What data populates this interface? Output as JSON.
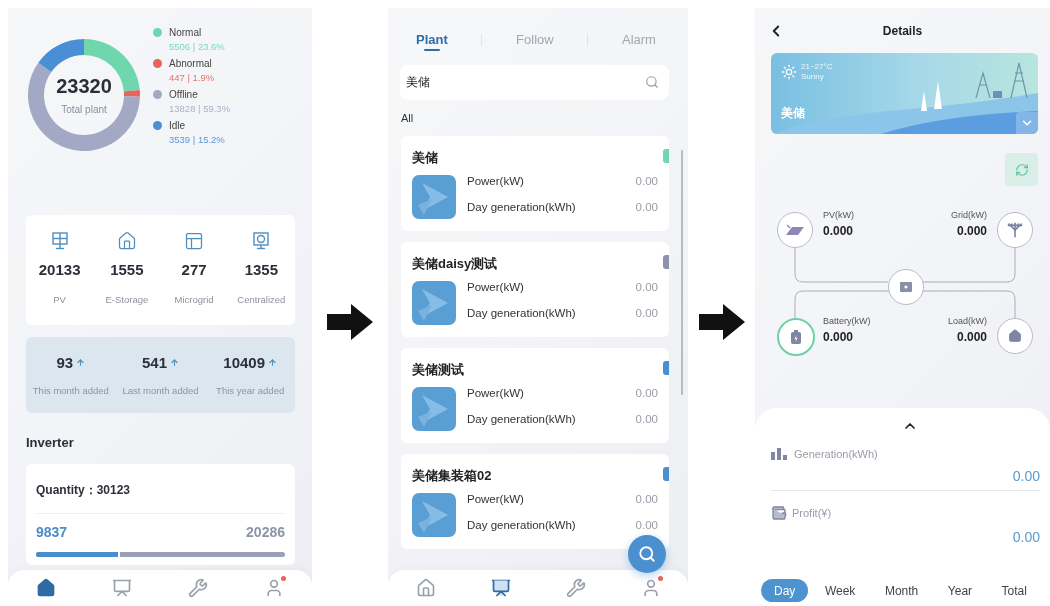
{
  "home_screen": {
    "status_chart": {
      "total": "23320",
      "total_label": "Total plant",
      "chart_data": {
        "type": "donut",
        "categories": [
          "Normal",
          "Abnormal",
          "Offline",
          "Idle"
        ],
        "series": [
          {
            "values": [
              23.6,
              1.9,
              59.3,
              15.2
            ]
          }
        ]
      },
      "legend": [
        {
          "value": "5506 | 23.6%",
          "color": "#6fd6ae"
        },
        {
          "value": "447 | 1.9%",
          "color": "#e8645a"
        },
        {
          "value": "13828 | 59.3%",
          "color": "#a3a8c4"
        },
        {
          "value": "3539 | 15.2%",
          "color": "#4a8fd6"
        }
      ]
    },
    "categories": [
      {
        "kind": "pv",
        "count": "20133",
        "label": "PV"
      },
      {
        "kind": "storage",
        "count": "1555",
        "label": "E-Storage"
      },
      {
        "kind": "microgrid",
        "count": "277",
        "label": "Microgrid"
      },
      {
        "kind": "centralized",
        "count": "1355",
        "label": "Centralized"
      }
    ],
    "added": [
      {
        "count": "93",
        "label": "This month added"
      },
      {
        "count": "541",
        "label": "Last month added"
      },
      {
        "count": "10409",
        "label": "This year added"
      }
    ],
    "inverter": {
      "title": "Inverter",
      "quantity": "Quantity：30123",
      "online": "9837",
      "offline": "20286",
      "level": 0.33
    },
    "nav": [
      {
        "kind": "home",
        "selected": true,
        "badge": false
      },
      {
        "kind": "monitor",
        "selected": false,
        "badge": false
      },
      {
        "kind": "tools",
        "selected": false,
        "badge": false
      },
      {
        "kind": "user",
        "selected": false,
        "badge": true
      }
    ]
  },
  "plant_list_screen": {
    "tabs": [
      {
        "label": "Plant",
        "selected": true
      },
      {
        "label": "Follow",
        "selected": false
      },
      {
        "label": "Alarm",
        "selected": false
      }
    ],
    "search": {
      "value": "美储"
    },
    "filter": "All",
    "plants": [
      {
        "name": "美储",
        "color": "#6fd6ae",
        "rows": [
          {
            "label": "Power(kW)",
            "value": "0.00"
          },
          {
            "label": "Day generation(kWh)",
            "value": "0.00"
          }
        ]
      },
      {
        "name": "美储daisy测试",
        "color": "#8d93ad",
        "rows": [
          {
            "label": "Power(kW)",
            "value": "0.00"
          },
          {
            "label": "Day generation(kWh)",
            "value": "0.00"
          }
        ]
      },
      {
        "name": "美储测试",
        "color": "#4a8fd6",
        "rows": [
          {
            "label": "Power(kW)",
            "value": "0.00"
          },
          {
            "label": "Day generation(kWh)",
            "value": "0.00"
          }
        ]
      },
      {
        "name": "美储集装箱02",
        "color": "#4a8fd6",
        "rows": [
          {
            "label": "Power(kW)",
            "value": "0.00"
          },
          {
            "label": "Day generation(kWh)",
            "value": "0.00"
          }
        ]
      }
    ],
    "nav": [
      {
        "kind": "home",
        "selected": false,
        "badge": false
      },
      {
        "kind": "monitor",
        "selected": true,
        "badge": false
      },
      {
        "kind": "tools",
        "selected": false,
        "badge": false
      },
      {
        "kind": "user",
        "selected": false,
        "badge": true
      }
    ]
  },
  "details_screen": {
    "title": "Details",
    "banner": {
      "temperature": "21~27°C",
      "weather": "Sunny",
      "name": "美储"
    },
    "flow": [
      {
        "kind": "pv",
        "label": "PV(kW)",
        "value": "0.000"
      },
      {
        "kind": "grid",
        "label": "Grid(kW)",
        "value": "0.000"
      },
      {
        "kind": "battery",
        "label": "Battery(kW)",
        "value": "0.000"
      },
      {
        "kind": "load",
        "label": "Load(kW)",
        "value": "0.000"
      }
    ],
    "stats": [
      {
        "kind": "generation",
        "label": "Generation(kWh)",
        "value": "0.00"
      },
      {
        "kind": "profit",
        "label": "Profit(¥)",
        "value": "0.00"
      }
    ],
    "periods": [
      {
        "label": "Day",
        "selected": true
      },
      {
        "label": "Week",
        "selected": false
      },
      {
        "label": "Month",
        "selected": false
      },
      {
        "label": "Year",
        "selected": false
      },
      {
        "label": "Total",
        "selected": false
      }
    ]
  }
}
